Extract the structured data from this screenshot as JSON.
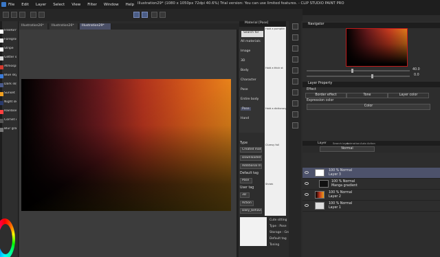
{
  "window": {
    "title": "Illustration29* (1080 x 1050px 72dpi 40.6%)  Trial version: You can use limited features. - CLIP STUDIO PAINT PRO"
  },
  "menu": [
    "File",
    "Edit",
    "Layer",
    "Select",
    "View",
    "Filter",
    "Window",
    "Help"
  ],
  "doc_tabs": [
    "Illustration26*",
    "Illustration26*",
    "Illustration29*"
  ],
  "brushes": [
    {
      "label": "Freeform",
      "color": "#ffffff"
    },
    {
      "label": "Foreground",
      "color": "#eeeeee"
    },
    {
      "label": "Stripe",
      "color": "#ffffff"
    },
    {
      "label": "Glitter stripe",
      "color": "#d8d8d8"
    },
    {
      "label": "Atmosphere",
      "color": "#d23a2e"
    },
    {
      "label": "Blue sky",
      "color": "#3a7ad8"
    },
    {
      "label": "Dark sky",
      "color": "#4a5a8a"
    },
    {
      "label": "Sunset",
      "color": "#f0a020"
    },
    {
      "label": "Night sky",
      "color": "#2a3a6a"
    },
    {
      "label": "Rainbow",
      "color": "#ff4040"
    },
    {
      "label": "Cornet erase",
      "color": "#555555"
    },
    {
      "label": "Blur gradient",
      "color": "#777777"
    }
  ],
  "material": {
    "header": "Material [Pose]",
    "search_placeholder": "Search for",
    "tree": [
      {
        "label": "All materials",
        "selected": false
      },
      {
        "label": "Image",
        "selected": false
      },
      {
        "label": "3D",
        "selected": false
      },
      {
        "label": "Body",
        "selected": false
      },
      {
        "label": "Character",
        "selected": false
      },
      {
        "label": "Pose",
        "selected": false
      },
      {
        "label": "Entire body",
        "selected": false
      },
      {
        "label": "Pose",
        "selected": true
      },
      {
        "label": "Hand",
        "selected": false
      }
    ],
    "thumb_captions": [
      "Hold a pumpkin",
      "Hold a thick st",
      "Hold a dictionary",
      "Clumsy fall",
      "Shriek",
      ""
    ],
    "type_label": "Type",
    "type_values": [
      "Created material",
      "Downloaded",
      "Additional material"
    ],
    "default_tag_label": "Default tag",
    "default_tag_value": "Pose",
    "user_tag_label": "User tag",
    "user_tag_values": [
      "3D",
      "Action",
      "Daily_behavior"
    ],
    "detail": {
      "name": "Cute sitting",
      "type": "Type : Pose",
      "storage": "Storage : Gro",
      "default_tag": "Default tag",
      "toning": "Toning"
    }
  },
  "navigator": {
    "header": "Navigator",
    "zoom": "40.0",
    "angle": "0.0"
  },
  "layer_property": {
    "header": "Layer Property",
    "effect_label": "Effect",
    "effects": [
      "Border effect",
      "Tone",
      "Layer color"
    ],
    "expression_label": "Expression color",
    "expression_value": "Color"
  },
  "layers": {
    "tabs": [
      "Layer",
      "Search layer",
      "Animation",
      "Auto Action"
    ],
    "blend_mode": "Normal",
    "items": [
      {
        "line1": "100 % Normal",
        "line2": "Layer 3",
        "selected": true,
        "thumb": "#ffffff"
      },
      {
        "line1": "100 % Normal",
        "line2": "Manga gradient",
        "selected": false,
        "thumb": "#111111"
      },
      {
        "line1": "100 % Normal",
        "line2": "Layer 2",
        "selected": false,
        "thumb": "gradient"
      },
      {
        "line1": "100 % Normal",
        "line2": "Layer 1",
        "selected": false,
        "thumb": "#dddddd"
      }
    ]
  }
}
